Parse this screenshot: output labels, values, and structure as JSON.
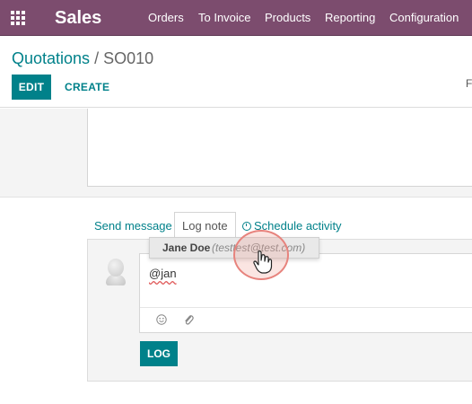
{
  "navbar": {
    "app_title": "Sales",
    "menu": [
      "Orders",
      "To Invoice",
      "Products",
      "Reporting",
      "Configuration"
    ],
    "background_color": "#7c4c6e"
  },
  "breadcrumb": {
    "parent": "Quotations",
    "separator": "/",
    "current": "SO010"
  },
  "toolbar": {
    "edit_label": "EDIT",
    "create_label": "CREATE",
    "right_fragment": "F"
  },
  "chatter": {
    "tabs": {
      "send_message": "Send message",
      "log_note": "Log note",
      "schedule_activity": "Schedule activity"
    },
    "composer_text": "@jan",
    "log_button_label": "LOG",
    "mention_suggestion": {
      "name": "Jane Doe",
      "email": "(testtest@test.com)"
    }
  },
  "accent_color": "#00818a",
  "icons": {
    "apps": "grid-icon",
    "activity": "clock-icon",
    "emoji": "smiley-icon",
    "attachment": "paperclip-icon",
    "cursor": "hand-pointer-icon"
  }
}
